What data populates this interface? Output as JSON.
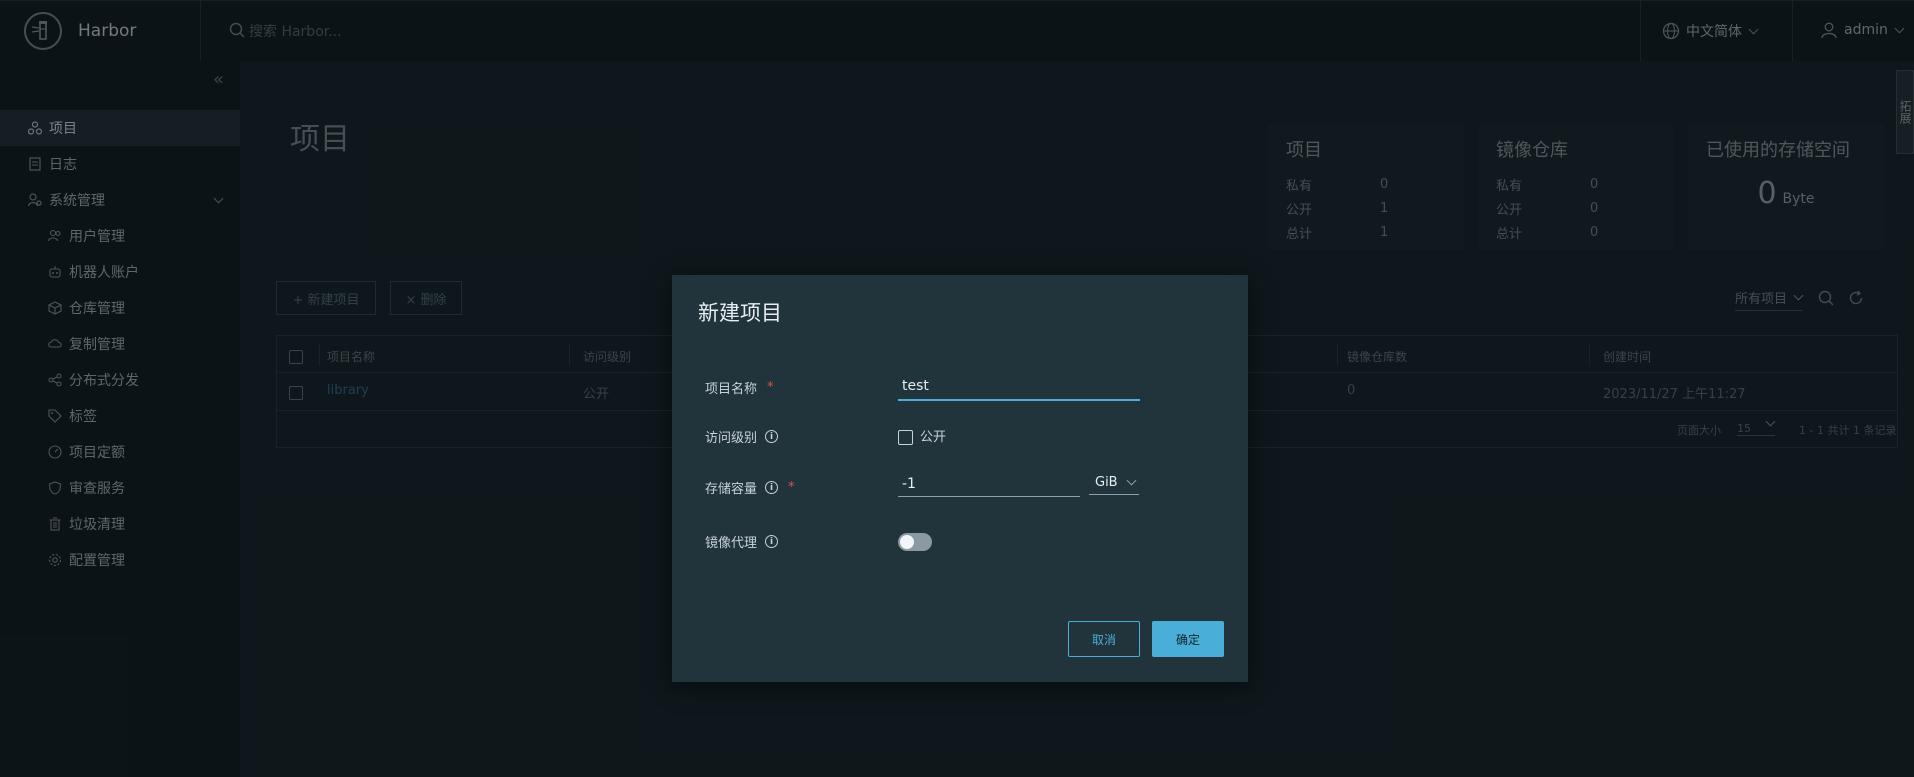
{
  "header": {
    "brand": "Harbor",
    "search_placeholder": "搜索 Harbor...",
    "language": "中文简体",
    "user": "admin"
  },
  "sidebar": {
    "items": [
      {
        "label": "项目",
        "icon": "projects-icon",
        "active": true
      },
      {
        "label": "日志",
        "icon": "logs-icon"
      },
      {
        "label": "系统管理",
        "icon": "system-admin-icon",
        "expandable": true
      },
      {
        "label": "用户管理",
        "icon": "users-icon"
      },
      {
        "label": "机器人账户",
        "icon": "robot-icon"
      },
      {
        "label": "仓库管理",
        "icon": "registry-icon"
      },
      {
        "label": "复制管理",
        "icon": "replication-icon"
      },
      {
        "label": "分布式分发",
        "icon": "distribution-icon"
      },
      {
        "label": "标签",
        "icon": "tag-icon"
      },
      {
        "label": "项目定额",
        "icon": "quota-icon"
      },
      {
        "label": "审查服务",
        "icon": "shield-icon"
      },
      {
        "label": "垃圾清理",
        "icon": "trash-icon"
      },
      {
        "label": "配置管理",
        "icon": "gear-icon"
      }
    ]
  },
  "main": {
    "title": "项目",
    "cards": {
      "projects": {
        "title": "项目",
        "rows": [
          {
            "label": "私有",
            "value": "0"
          },
          {
            "label": "公开",
            "value": "1"
          },
          {
            "label": "总计",
            "value": "1"
          }
        ]
      },
      "repos": {
        "title": "镜像仓库",
        "rows": [
          {
            "label": "私有",
            "value": "0"
          },
          {
            "label": "公开",
            "value": "0"
          },
          {
            "label": "总计",
            "value": "0"
          }
        ]
      },
      "storage": {
        "title": "已使用的存储空间",
        "value": "0",
        "unit": "Byte"
      }
    },
    "new_project_label": "+ 新建项目",
    "delete_label": "× 删除",
    "filter_label": "所有项目",
    "table": {
      "headers": [
        "项目名称",
        "访问级别",
        "镜像仓库数",
        "创建时间"
      ],
      "rows": [
        {
          "name": "library",
          "access": "公开",
          "repo_count": "0",
          "created": "2023/11/27 上午11:27"
        }
      ],
      "page_size_label": "页面大小",
      "page_size": "15",
      "summary": "1 - 1 共计 1 条记录"
    }
  },
  "side_tab": "拓展",
  "modal": {
    "title": "新建项目",
    "project_name_label": "项目名称",
    "project_name_value": "test",
    "access_label": "访问级别",
    "public_label": "公开",
    "storage_label": "存储容量",
    "storage_value": "-1",
    "storage_unit": "GiB",
    "proxy_label": "镜像代理",
    "cancel_label": "取消",
    "ok_label": "确定"
  }
}
